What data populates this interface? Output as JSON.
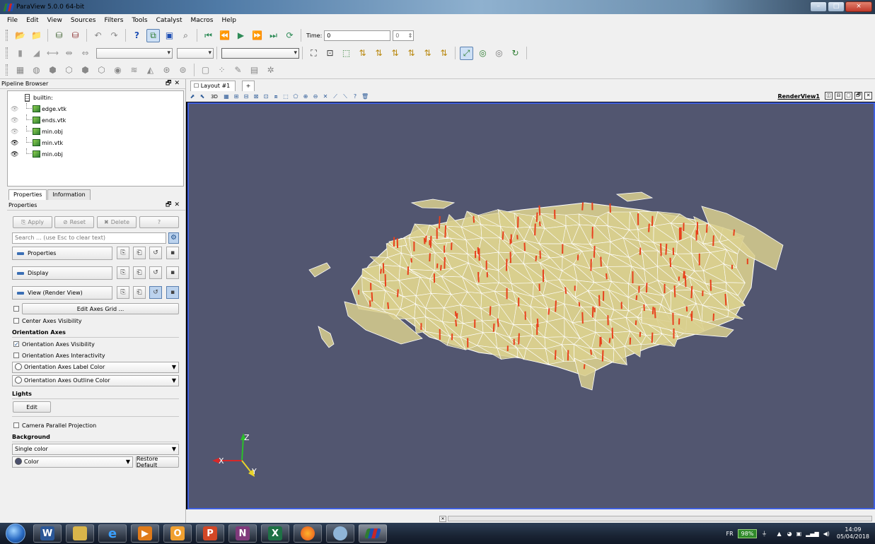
{
  "window": {
    "title": "ParaView 5.0.0 64-bit",
    "controls": [
      "–",
      "□",
      "×"
    ]
  },
  "menu": [
    "File",
    "Edit",
    "View",
    "Sources",
    "Filters",
    "Tools",
    "Catalyst",
    "Macros",
    "Help"
  ],
  "time_toolbar": {
    "time_label": "Time:",
    "time_value": "0",
    "timestep_value": "0"
  },
  "pipeline_browser": {
    "title": "Pipeline Browser",
    "root": "builtin:",
    "items": [
      {
        "name": "edge.vtk",
        "visible": false
      },
      {
        "name": "ends.vtk",
        "visible": false
      },
      {
        "name": "min.obj",
        "visible": false
      },
      {
        "name": "min.vtk",
        "visible": true
      },
      {
        "name": "min.obj",
        "visible": true
      }
    ]
  },
  "panel_tabs": [
    "Properties",
    "Information"
  ],
  "properties": {
    "title": "Properties",
    "apply": "Apply",
    "reset": "Reset",
    "delete": "Delete",
    "help": "?",
    "search_placeholder": "Search ... (use Esc to clear text)",
    "sections": [
      "Properties",
      "Display",
      "View (Render View)"
    ],
    "edit_axes_grid": "Edit Axes Grid ...",
    "center_axes_visibility": "Center Axes Visibility",
    "orientation_axes_group": "Orientation Axes",
    "orientation_axes_visibility": "Orientation Axes Visibility",
    "orientation_axes_interactivity": "Orientation Axes Interactivity",
    "orientation_axes_label_color": "Orientation Axes Label Color",
    "orientation_axes_outline_color": "Orientation Axes Outline Color",
    "lights_group": "Lights",
    "lights_edit": "Edit",
    "camera_parallel_projection": "Camera Parallel Projection",
    "background_group": "Background",
    "background_mode": "Single color",
    "color_label": "Color",
    "restore_default": "Restore Default"
  },
  "layout": {
    "tab": "Layout #1",
    "tab_close": "×",
    "add_tab": "+",
    "view_name": "RenderView1",
    "view_3d": "3D"
  },
  "render": {
    "background_color": "#525670",
    "mesh_fill": "#d9cf8e",
    "mesh_edge": "#ffffff",
    "marker_color": "#e8401c",
    "axes": {
      "x": "X",
      "y": "Y",
      "z": "Z"
    }
  },
  "taskbar": {
    "apps": [
      "W",
      "folder",
      "e",
      "media",
      "O",
      "P",
      "N",
      "X",
      "firefox",
      "explorer",
      "paraview"
    ],
    "language": "FR",
    "battery": "98%",
    "time": "14:09",
    "date": "05/04/2018"
  }
}
